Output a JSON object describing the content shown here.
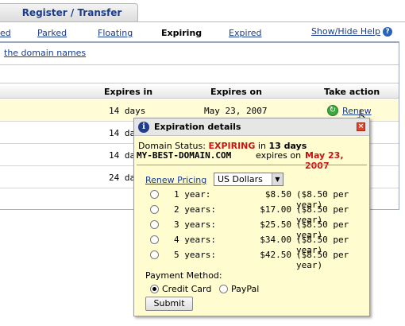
{
  "top_tab": {
    "label": "Register / Transfer"
  },
  "nav": {
    "items": [
      {
        "label": "ed",
        "active": false
      },
      {
        "label": "Parked",
        "active": false
      },
      {
        "label": "Floating",
        "active": false
      },
      {
        "label": "Expiring",
        "active": true
      },
      {
        "label": "Expired",
        "active": false
      }
    ],
    "help": "Show/Hide Help",
    "help_icon": "question-circle-icon"
  },
  "domain_names_link": "the domain names",
  "table": {
    "headers": [
      "Expires in",
      "Expires on",
      "Take action"
    ],
    "rows": [
      {
        "expires_in": "14 days",
        "expires_on": "May 23, 2007",
        "action": "Renew"
      },
      {
        "expires_in": "14 day"
      },
      {
        "expires_in": "14 day"
      },
      {
        "expires_in": "24 day"
      }
    ]
  },
  "popup": {
    "title": "Expiration details",
    "status_label": "Domain Status:",
    "status_value": "EXPIRING",
    "status_in": "in",
    "status_days": "13 days",
    "domain": "MY-BEST-DOMAIN.COM",
    "expires_on_label": "expires on",
    "expires_on_value": "May 23, 2007",
    "renew_pricing": "Renew Pricing",
    "currency": "US Dollars",
    "options": [
      {
        "term": "1 year:",
        "price": "$8.50",
        "per_year": "($8.50 per year)"
      },
      {
        "term": "2 years:",
        "price": "$17.00",
        "per_year": "($8.50 per year)"
      },
      {
        "term": "3 years:",
        "price": "$25.50",
        "per_year": "($8.50 per year)"
      },
      {
        "term": "4 years:",
        "price": "$34.00",
        "per_year": "($8.50 per year)"
      },
      {
        "term": "5 years:",
        "price": "$42.50",
        "per_year": "($8.50 per year)"
      }
    ],
    "payment_method_label": "Payment Method:",
    "payment_options": [
      "Credit Card",
      "PayPal"
    ],
    "payment_selected": "Credit Card",
    "submit": "Submit"
  }
}
